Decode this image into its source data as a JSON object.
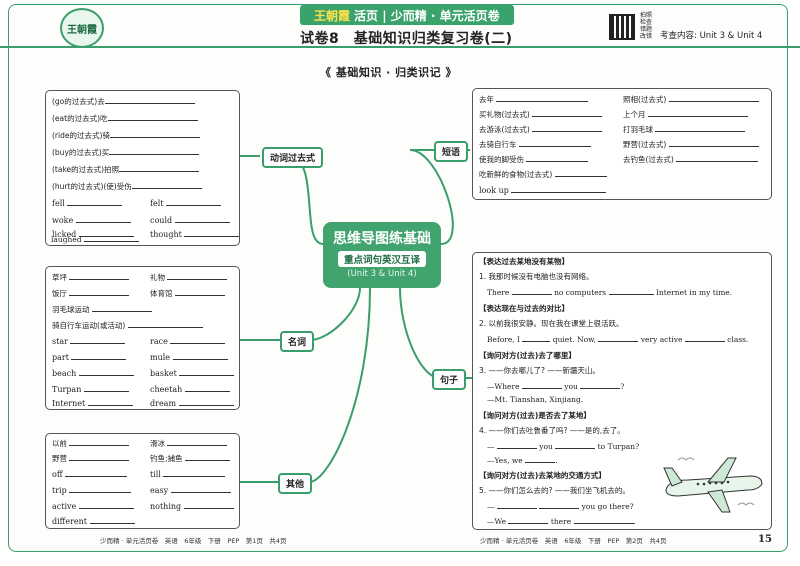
{
  "header": {
    "logo": "王朝霞",
    "brand": "王朝霞",
    "series": "活页 | 少而精 · 单元活页卷",
    "title": "试卷8　基础知识归类复习卷(二)",
    "qr_text": "拍照检查错题改错",
    "scope": "考查内容: Unit 3 & Unit 4"
  },
  "section_title": "《 基础知识 · 归类识记 》",
  "center": {
    "line1": "思维导图练基础",
    "line2": "重点词句英汉互译",
    "line3": "(Unit 3 & Unit 4)"
  },
  "branches": {
    "verbs": "动词过去式",
    "phrases": "短语",
    "nouns": "名词",
    "sentences": "句子",
    "others": "其他"
  },
  "verbs": {
    "rows": [
      "(go的过去式)去",
      "(eat的过去式)吃",
      "(ride的过去式)骑",
      "(buy的过去式)买",
      "(take的过去式)拍照",
      "(hurt的过去式)(使)受伤"
    ],
    "words": [
      "fell",
      "felt",
      "woke",
      "could",
      "licked",
      "thought",
      "laughed"
    ]
  },
  "phrases": {
    "left": [
      "去年",
      "买礼物(过去式)",
      "去游泳(过去式)",
      "去骑自行车",
      "使我的脚受伤",
      "吃新鲜的食物(过去式)",
      "look up"
    ],
    "right": [
      "照相(过去式)",
      "上个月",
      "打羽毛球",
      "野营(过去式)",
      "去钓鱼(过去式)"
    ]
  },
  "nouns": {
    "cn": [
      "草坪",
      "礼物",
      "饭厅",
      "体育馆",
      "羽毛球运动",
      "骑自行车运动(或活动)"
    ],
    "en": [
      "star",
      "race",
      "part",
      "mule",
      "beach",
      "basket",
      "Turpan",
      "cheetah",
      "Internet",
      "dream"
    ]
  },
  "others": {
    "words": [
      "以前",
      "滑冰",
      "野营",
      "钓鱼;捕鱼",
      "off",
      "till",
      "trip",
      "easy",
      "active",
      "nothing",
      "different"
    ]
  },
  "sentences": {
    "s1_tag": "【表达过去某地没有某物】",
    "s1_q": "1. 我那时候没有电脑也没有网络。",
    "s1_a1": "There",
    "s1_a2": "no computers",
    "s1_a3": "Internet in my time.",
    "s2_tag": "【表达现在与过去的对比】",
    "s2_q": "2. 以前我很安静。现在我在课堂上很活跃。",
    "s2_a1": "Before, I",
    "s2_a2": "quiet. Now,",
    "s2_a3": "very active",
    "s2_a4": "class.",
    "s3_tag": "【询问对方(过去)去了哪里】",
    "s3_q": "3. ——你去哪儿了? ——新疆天山。",
    "s3_a1": "—Where",
    "s3_a2": "you",
    "s3_a3": "?",
    "s3_b": "—Mt. Tianshan, Xinjiang.",
    "s4_tag": "【询问对方(过去)是否去了某地】",
    "s4_q": "4. ——你们去吐鲁番了吗? ——是的,去了。",
    "s4_a1": "—",
    "s4_a2": "you",
    "s4_a3": "to Turpan?",
    "s4_b1": "—Yes, we",
    "s4_b2": ".",
    "s5_tag": "【询问对方(过去)去某地的交通方式】",
    "s5_q": "5. ——你们怎么去的? ——我们坐飞机去的。",
    "s5_a1": "—",
    "s5_a2": "you go there?",
    "s5_b1": "—We",
    "s5_b2": "there",
    "s5_b3": "."
  },
  "footer": {
    "left": "少而精 · 单元活页卷　英语　6年级　下册　PEP　第1页　共4页",
    "right": "少而精 · 单元活页卷　英语　6年级　下册　PEP　第2页　共4页",
    "page": "15"
  },
  "colors": {
    "accent": "#3a9e6a",
    "brand_yellow": "#ffe14a"
  }
}
